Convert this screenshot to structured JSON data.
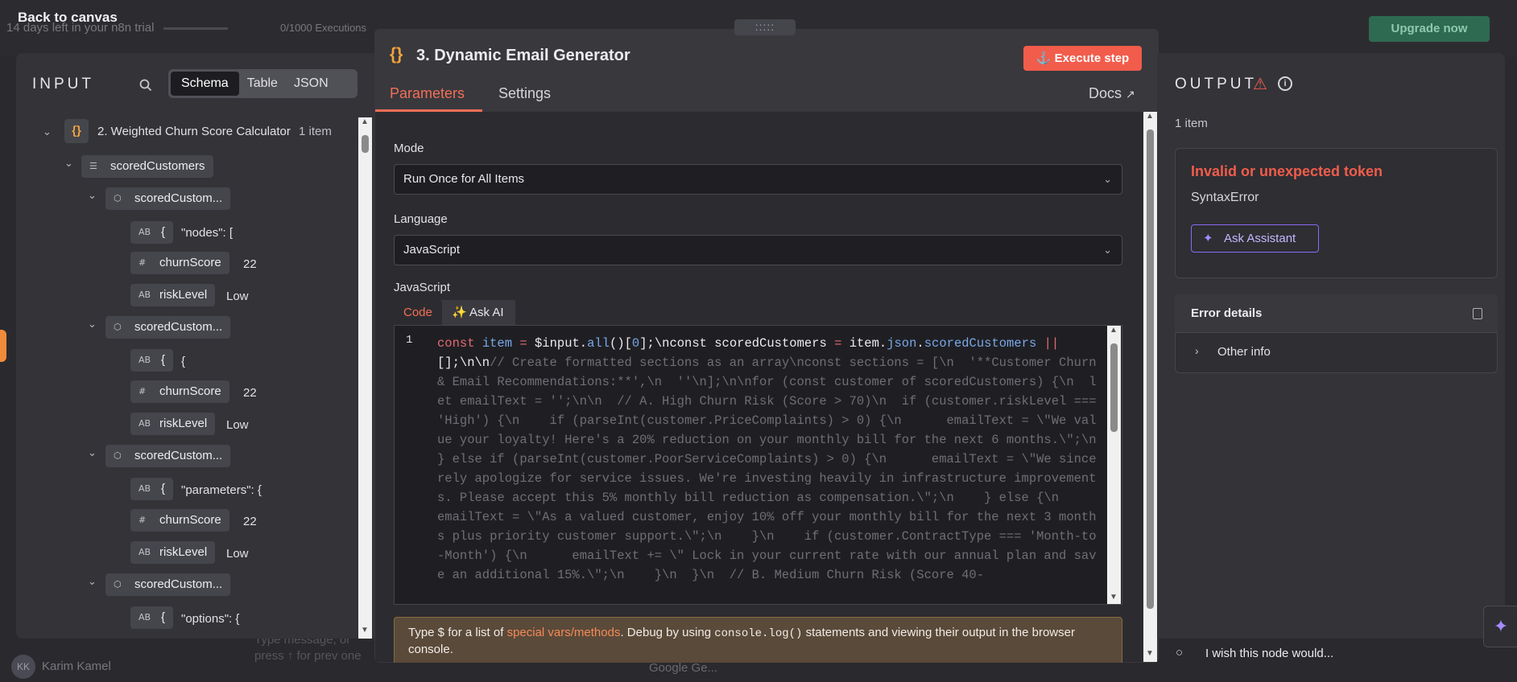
{
  "background": {
    "trial_text": "14 days left in your n8n trial",
    "executions": "0/1000 Executions",
    "back_label": "Back to canvas",
    "upgrade_label": "Upgrade now",
    "user_initials": "KK",
    "user_name": "Karim Kamel",
    "message_placeholder": "Type message, or press ↑ for prev one",
    "google_label": "Google Ge..."
  },
  "input": {
    "title": "INPUT",
    "views": [
      "Schema",
      "Table",
      "JSON"
    ],
    "active_view": "Schema",
    "node_name": "2. Weighted Churn Score Calculator",
    "node_count": "1 item",
    "root_field": "scoredCustomers",
    "groups": [
      {
        "label": "scoredCustom...",
        "fields": [
          {
            "type": "AB",
            "name": "{",
            "value": "\"nodes\": ["
          },
          {
            "type": "#",
            "name": "churnScore",
            "value": "22"
          },
          {
            "type": "AB",
            "name": "riskLevel",
            "value": "Low"
          }
        ]
      },
      {
        "label": "scoredCustom...",
        "fields": [
          {
            "type": "AB",
            "name": "{",
            "value": "{"
          },
          {
            "type": "#",
            "name": "churnScore",
            "value": "22"
          },
          {
            "type": "AB",
            "name": "riskLevel",
            "value": "Low"
          }
        ]
      },
      {
        "label": "scoredCustom...",
        "fields": [
          {
            "type": "AB",
            "name": "{",
            "value": "\"parameters\": {"
          },
          {
            "type": "#",
            "name": "churnScore",
            "value": "22"
          },
          {
            "type": "AB",
            "name": "riskLevel",
            "value": "Low"
          }
        ]
      },
      {
        "label": "scoredCustom...",
        "fields": [
          {
            "type": "AB",
            "name": "{",
            "value": "\"options\": {"
          }
        ]
      }
    ]
  },
  "modal": {
    "title": "3. Dynamic Email Generator",
    "execute_label": "Execute step",
    "tabs": [
      "Parameters",
      "Settings"
    ],
    "docs_label": "Docs",
    "mode_label": "Mode",
    "mode_value": "Run Once for All Items",
    "language_label": "Language",
    "language_value": "JavaScript",
    "code_section_label": "JavaScript",
    "code_tab": "Code",
    "ask_ai_tab": "✨ Ask AI",
    "line_number": "1",
    "code_rest": "// Create formatted sections as an array\\nconst sections = [\\n  '**Customer Churn & Email Recommendations:**',\\n  ''\\n];\\n\\nfor (const customer of scoredCustomers) {\\n  let emailText = '';\\n\\n  // A. High Churn Risk (Score > 70)\\n  if (customer.riskLevel === 'High') {\\n    if (parseInt(customer.PriceComplaints) > 0) {\\n      emailText = \\\"We value your loyalty! Here's a 20% reduction on your monthly bill for the next 6 months.\\\";\\n    } else if (parseInt(customer.PoorServiceComplaints) > 0) {\\n      emailText = \\\"We sincerely apologize for service issues. We're investing heavily in infrastructure improvements. Please accept this 5% monthly bill reduction as compensation.\\\";\\n    } else {\\n      emailText = \\\"As a valued customer, enjoy 10% off your monthly bill for the next 3 months plus priority customer support.\\\";\\n    }\\n    if (customer.ContractType === 'Month-to-Month') {\\n      emailText += \\\" Lock in your current rate with our annual plan and save an additional 15%.\\\";\\n    }\\n  }\\n  // B. Medium Churn Risk (Score 40-",
    "hint_pre": "Type $ for a list of ",
    "hint_link": "special vars/methods",
    "hint_mid": ". Debug by using ",
    "hint_code": "console.log()",
    "hint_post": " statements and viewing their output in the browser console."
  },
  "output": {
    "title": "OUTPUT",
    "count": "1 item",
    "error_title": "Invalid or unexpected token",
    "error_type": "SyntaxError",
    "assistant_label": "Ask Assistant",
    "details_title": "Error details",
    "other_info": "Other info",
    "wish_label": "I wish this node would..."
  },
  "colors": {
    "accent": "#f46e56",
    "error": "#f25c4b",
    "assistant": "#8b6bf2",
    "node_icon": "#f2a33c"
  }
}
